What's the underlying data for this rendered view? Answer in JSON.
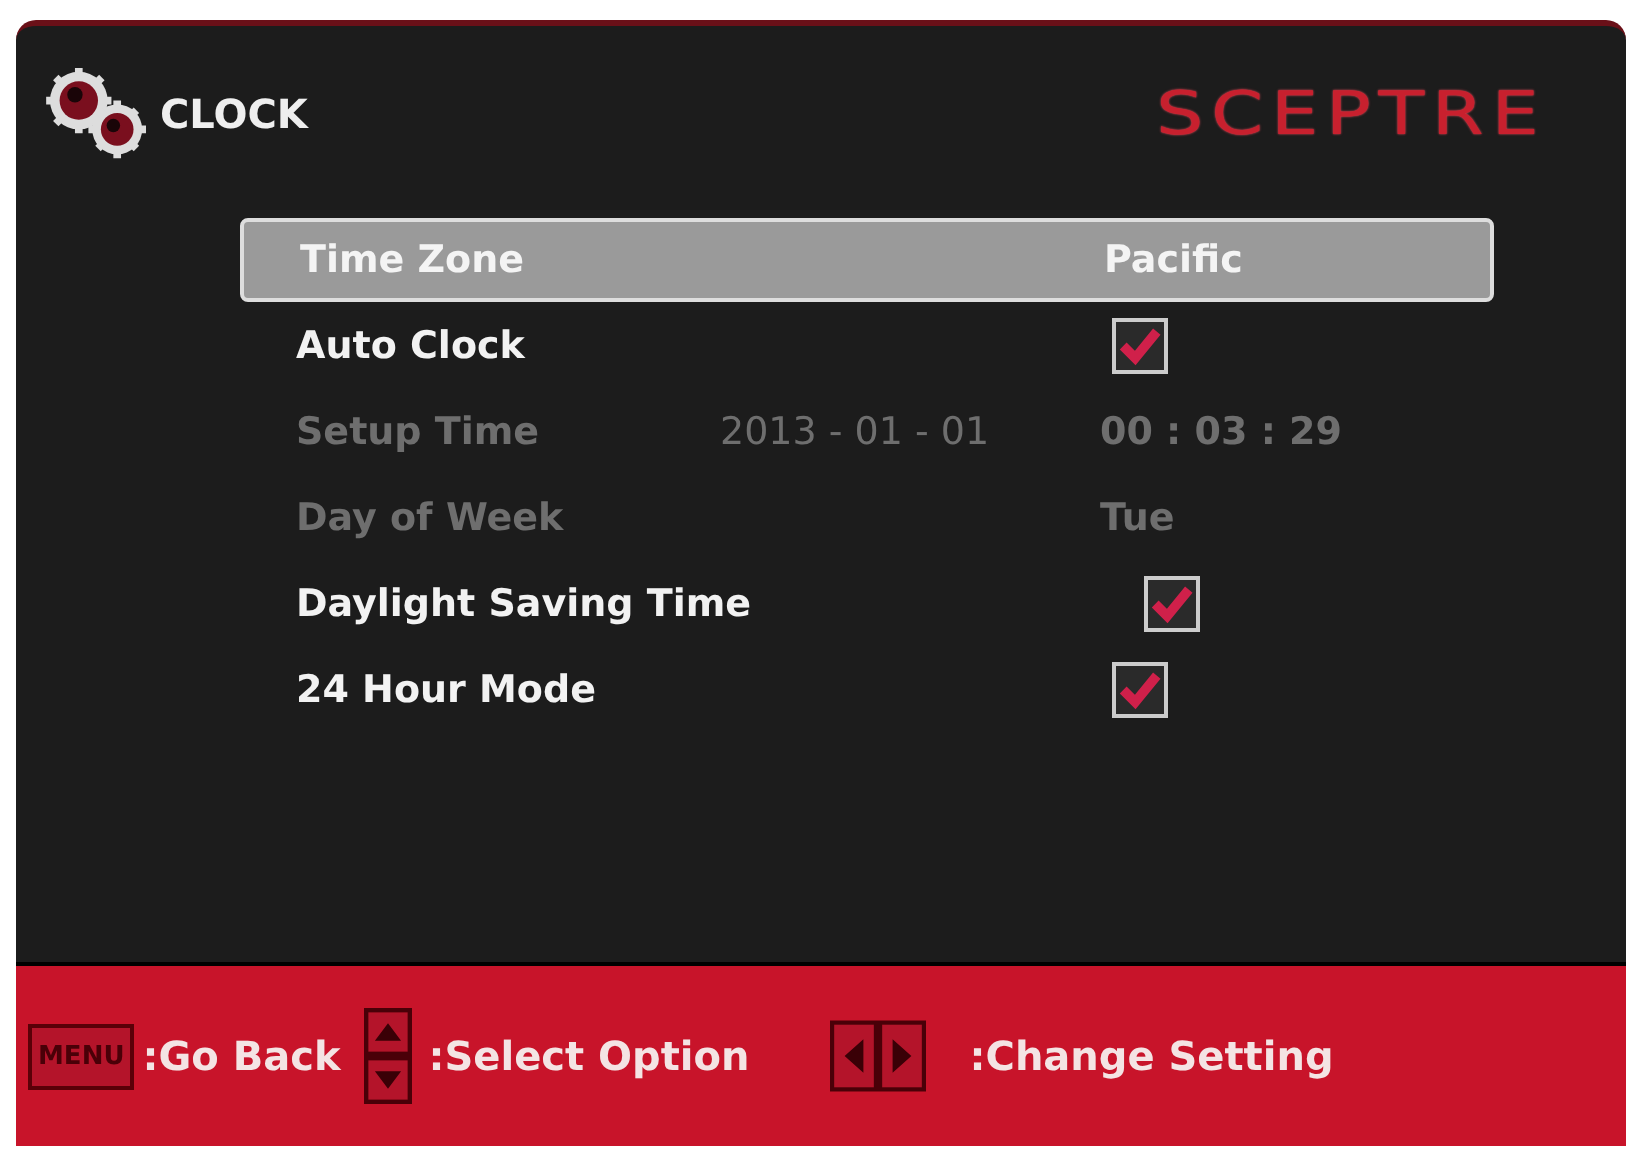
{
  "header": {
    "title": "CLOCK",
    "brand": "SCEPTRE"
  },
  "rows": [
    {
      "kind": "value",
      "label": "Time Zone",
      "value": "Pacific",
      "selected": true,
      "disabled": false
    },
    {
      "kind": "checkbox",
      "label": "Auto Clock",
      "checked": true,
      "selected": false,
      "disabled": false
    },
    {
      "kind": "datetime",
      "label": "Setup Time",
      "date": "2013 - 01 - 01",
      "value": "00 : 03 : 29",
      "selected": false,
      "disabled": true
    },
    {
      "kind": "value",
      "label": "Day of Week",
      "value": "Tue",
      "selected": false,
      "disabled": true
    },
    {
      "kind": "checkbox",
      "label": "Daylight Saving Time",
      "checked": true,
      "selected": false,
      "disabled": false
    },
    {
      "kind": "checkbox",
      "label": "24 Hour Mode",
      "checked": true,
      "selected": false,
      "disabled": false
    }
  ],
  "footer": [
    {
      "kind": "menu",
      "key": "MENU",
      "label": ":Go Back"
    },
    {
      "kind": "updown",
      "label": ":Select Option"
    },
    {
      "kind": "leftright",
      "label": ":Change Setting"
    }
  ]
}
